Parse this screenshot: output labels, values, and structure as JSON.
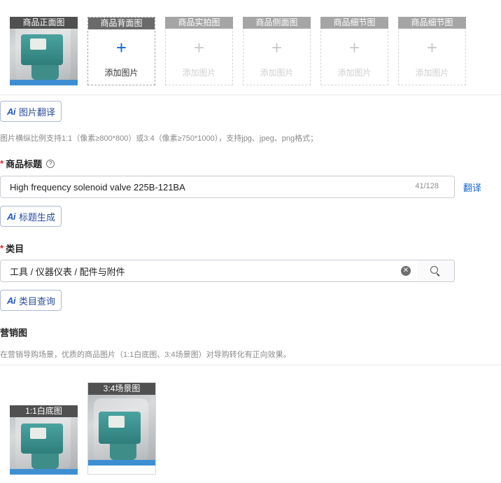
{
  "image_slots": [
    {
      "caption": "商品正面图",
      "state": "filled"
    },
    {
      "caption": "商品背面图",
      "state": "active",
      "add_label": "添加图片"
    },
    {
      "caption": "商品实拍图",
      "state": "empty",
      "add_label": "添加图片"
    },
    {
      "caption": "商品侧面图",
      "state": "empty",
      "add_label": "添加图片"
    },
    {
      "caption": "商品细节图",
      "state": "empty",
      "add_label": "添加图片"
    },
    {
      "caption": "商品细节图",
      "state": "empty",
      "add_label": "添加图片"
    }
  ],
  "ai_translate_button": {
    "icon_text": "Ai",
    "label": "图片翻译"
  },
  "image_hint": "图片横纵比例支持1:1（像素≥800*800）或3:4（像素≥750*1000），支持jpg、jpeg、png格式；",
  "title_field": {
    "required_mark": "*",
    "label": "商品标题",
    "value": "High frequency solenoid valve 225B-121BA",
    "counter": "41/128",
    "translate_link": "翻译"
  },
  "ai_title_button": {
    "icon_text": "Ai",
    "label": "标题生成"
  },
  "category_field": {
    "required_mark": "*",
    "label": "类目",
    "value": "工具 / 仪器仪表 / 配件与附件"
  },
  "ai_category_button": {
    "icon_text": "Ai",
    "label": "类目查询"
  },
  "marketing": {
    "heading": "营销图",
    "hint": "在营销导购场景，优质的商品图片（1:1白底图、3:4场景图）对导购转化有正向效果。",
    "images": [
      {
        "caption": "1:1白底图"
      },
      {
        "caption": "3:4场景图"
      }
    ]
  },
  "colors": {
    "accent": "#1566d6",
    "required": "#e0262b",
    "ai_border": "#aeb8d8"
  }
}
